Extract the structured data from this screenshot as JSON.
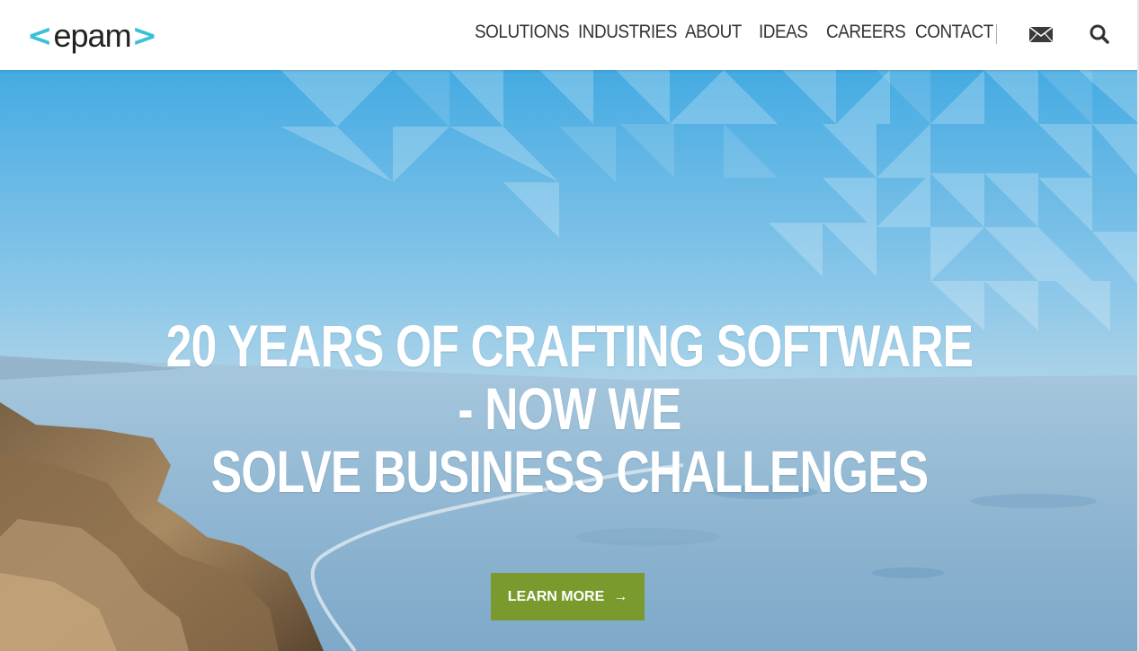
{
  "header": {
    "logo": {
      "open": "<",
      "word": "epam",
      "close": ">"
    },
    "nav": [
      {
        "label": "SOLUTIONS"
      },
      {
        "label": "INDUSTRIES"
      },
      {
        "label": "ABOUT"
      },
      {
        "label": "IDEAS"
      },
      {
        "label": "CAREERS"
      },
      {
        "label": "CONTACT"
      }
    ],
    "icons": [
      "mail-icon",
      "search-icon"
    ]
  },
  "hero": {
    "headline_line1": "20 YEARS OF CRAFTING SOFTWARE - NOW WE",
    "headline_line2": "SOLVE BUSINESS CHALLENGES",
    "cta_label": "LEARN MORE",
    "cta_arrow": "→"
  },
  "colors": {
    "brand_accent": "#39c2d7",
    "cta_background": "#7a9a2e",
    "header_background": "#ffffff"
  }
}
